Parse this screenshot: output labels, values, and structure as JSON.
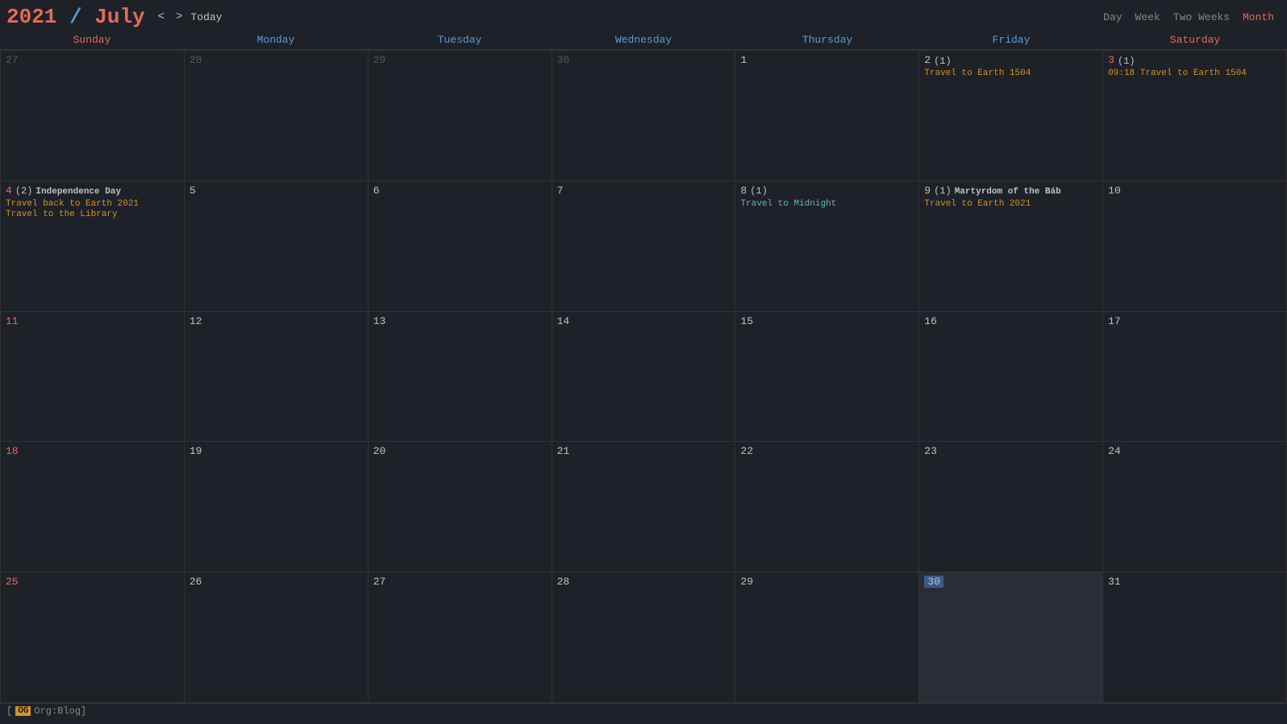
{
  "header": {
    "year": "2021",
    "slash": " / ",
    "month": "July",
    "prev_label": "<",
    "next_label": ">",
    "today_label": "Today",
    "views": [
      "Day",
      "Week",
      "Two Weeks",
      "Month"
    ],
    "active_view": "Month"
  },
  "day_headers": [
    {
      "label": "Sunday",
      "type": "weekend"
    },
    {
      "label": "Monday",
      "type": "weekday"
    },
    {
      "label": "Tuesday",
      "type": "weekday"
    },
    {
      "label": "Wednesday",
      "type": "weekday"
    },
    {
      "label": "Thursday",
      "type": "weekday"
    },
    {
      "label": "Friday",
      "type": "weekday"
    },
    {
      "label": "Saturday",
      "type": "weekend"
    }
  ],
  "weeks": [
    {
      "days": [
        {
          "num": "27",
          "other": true,
          "events": []
        },
        {
          "num": "28",
          "other": true,
          "events": []
        },
        {
          "num": "29",
          "other": true,
          "events": []
        },
        {
          "num": "30",
          "other": true,
          "events": []
        },
        {
          "num": "1",
          "other": false,
          "events": []
        },
        {
          "num": "2",
          "other": false,
          "count": "(1)",
          "events": [
            {
              "text": "Travel to Earth 1504",
              "style": "orange"
            }
          ]
        },
        {
          "num": "3",
          "other": false,
          "weekend": true,
          "count": "(1)",
          "events": [
            {
              "text": "09:18 Travel to Earth 1504",
              "style": "orange"
            }
          ]
        }
      ]
    },
    {
      "days": [
        {
          "num": "4",
          "other": false,
          "weekend": true,
          "count": "(2)",
          "header_event": "Independence Day",
          "events": [
            {
              "text": "Travel back to Earth 2021",
              "style": "orange"
            },
            {
              "text": "Travel to the Library",
              "style": "orange"
            }
          ]
        },
        {
          "num": "5",
          "other": false,
          "events": []
        },
        {
          "num": "6",
          "other": false,
          "events": []
        },
        {
          "num": "7",
          "other": false,
          "events": []
        },
        {
          "num": "8",
          "other": false,
          "count": "(1)",
          "events": [
            {
              "text": "Travel to Midnight",
              "style": "cyan"
            }
          ]
        },
        {
          "num": "9",
          "other": false,
          "count": "(1)",
          "header_event": "Martyrdom of the Báb",
          "events": [
            {
              "text": "Travel to Earth 2021",
              "style": "orange"
            }
          ]
        },
        {
          "num": "10",
          "other": false,
          "events": []
        }
      ]
    },
    {
      "days": [
        {
          "num": "11",
          "other": false,
          "weekend": true,
          "events": []
        },
        {
          "num": "12",
          "other": false,
          "events": []
        },
        {
          "num": "13",
          "other": false,
          "events": []
        },
        {
          "num": "14",
          "other": false,
          "events": []
        },
        {
          "num": "15",
          "other": false,
          "events": []
        },
        {
          "num": "16",
          "other": false,
          "events": []
        },
        {
          "num": "17",
          "other": false,
          "events": []
        }
      ]
    },
    {
      "days": [
        {
          "num": "18",
          "other": false,
          "weekend": true,
          "events": []
        },
        {
          "num": "19",
          "other": false,
          "events": []
        },
        {
          "num": "20",
          "other": false,
          "events": []
        },
        {
          "num": "21",
          "other": false,
          "events": []
        },
        {
          "num": "22",
          "other": false,
          "events": []
        },
        {
          "num": "23",
          "other": false,
          "events": []
        },
        {
          "num": "24",
          "other": false,
          "events": []
        }
      ]
    },
    {
      "days": [
        {
          "num": "25",
          "other": false,
          "weekend": true,
          "events": []
        },
        {
          "num": "26",
          "other": false,
          "events": []
        },
        {
          "num": "27",
          "other": false,
          "events": []
        },
        {
          "num": "28",
          "other": false,
          "events": []
        },
        {
          "num": "29",
          "other": false,
          "events": []
        },
        {
          "num": "30",
          "other": false,
          "today": true,
          "events": []
        },
        {
          "num": "31",
          "other": false,
          "events": []
        }
      ]
    }
  ],
  "status_bar": {
    "tag": "OG",
    "text": "Org:Blog]"
  }
}
